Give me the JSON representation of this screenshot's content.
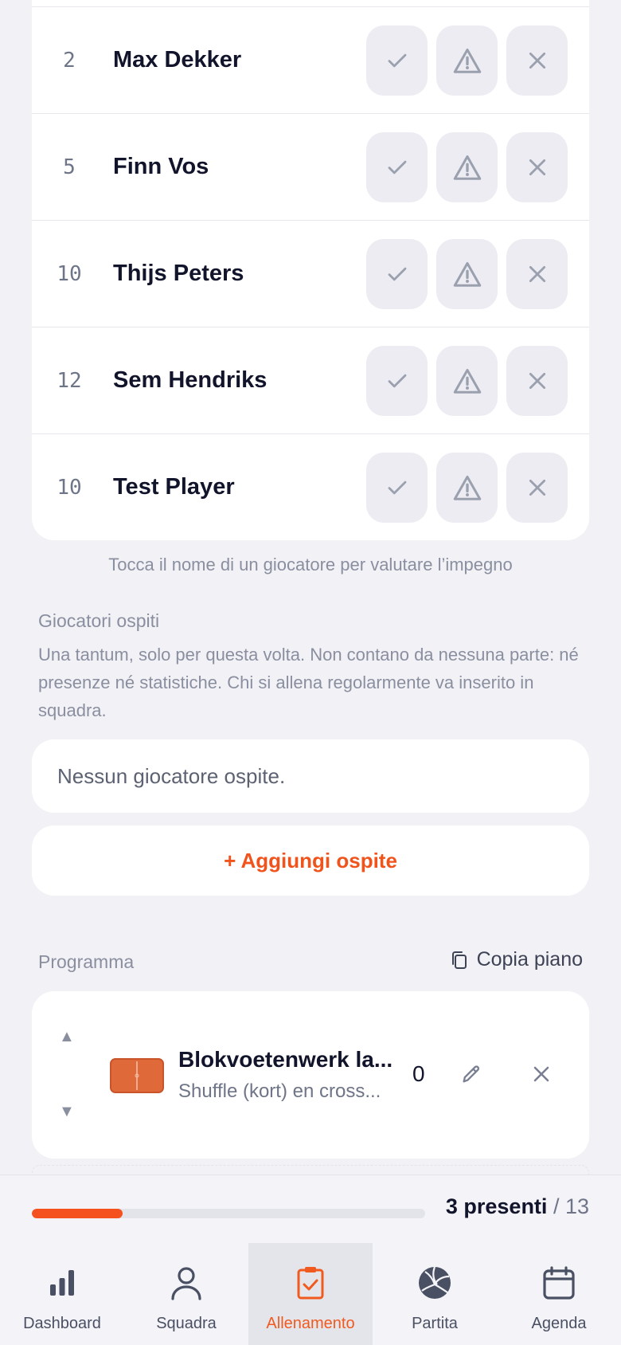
{
  "roster": {
    "players": [
      {
        "number": "2",
        "name": "Max Dekker"
      },
      {
        "number": "5",
        "name": "Finn Vos"
      },
      {
        "number": "10",
        "name": "Thijs Peters"
      },
      {
        "number": "12",
        "name": "Sem Hendriks"
      },
      {
        "number": "10",
        "name": "Test Player"
      }
    ],
    "hint": "Tocca il nome di un giocatore per valutare l’impegno"
  },
  "guests": {
    "title": "Giocatori ospiti",
    "description": "Una tantum, solo per questa volta. Non contano da nessuna parte: né presenze né statistiche. Chi si allena regolarmente va inserito in squadra.",
    "empty": "Nessun giocatore ospite.",
    "add_label": "+ Aggiungi ospite"
  },
  "program": {
    "title": "Programma",
    "copy_label": "Copia piano",
    "drills": [
      {
        "title": "Blokvoetenwerk la...",
        "subtitle": "Shuffle (kort) en cross...",
        "count": "0"
      }
    ]
  },
  "attendance": {
    "present_label": "3 presenti",
    "total_label": "/ 13",
    "present": 3,
    "total": 13
  },
  "tabs": [
    {
      "label": "Dashboard",
      "icon": "chart-bar-icon"
    },
    {
      "label": "Squadra",
      "icon": "person-icon"
    },
    {
      "label": "Allenamento",
      "icon": "clipboard-check-icon",
      "active": true
    },
    {
      "label": "Partita",
      "icon": "volleyball-icon"
    },
    {
      "label": "Agenda",
      "icon": "calendar-icon"
    }
  ],
  "colors": {
    "accent": "#f05a1e",
    "background": "#f1f1f6",
    "card": "#ffffff",
    "muted_text": "#8a8fa0"
  }
}
